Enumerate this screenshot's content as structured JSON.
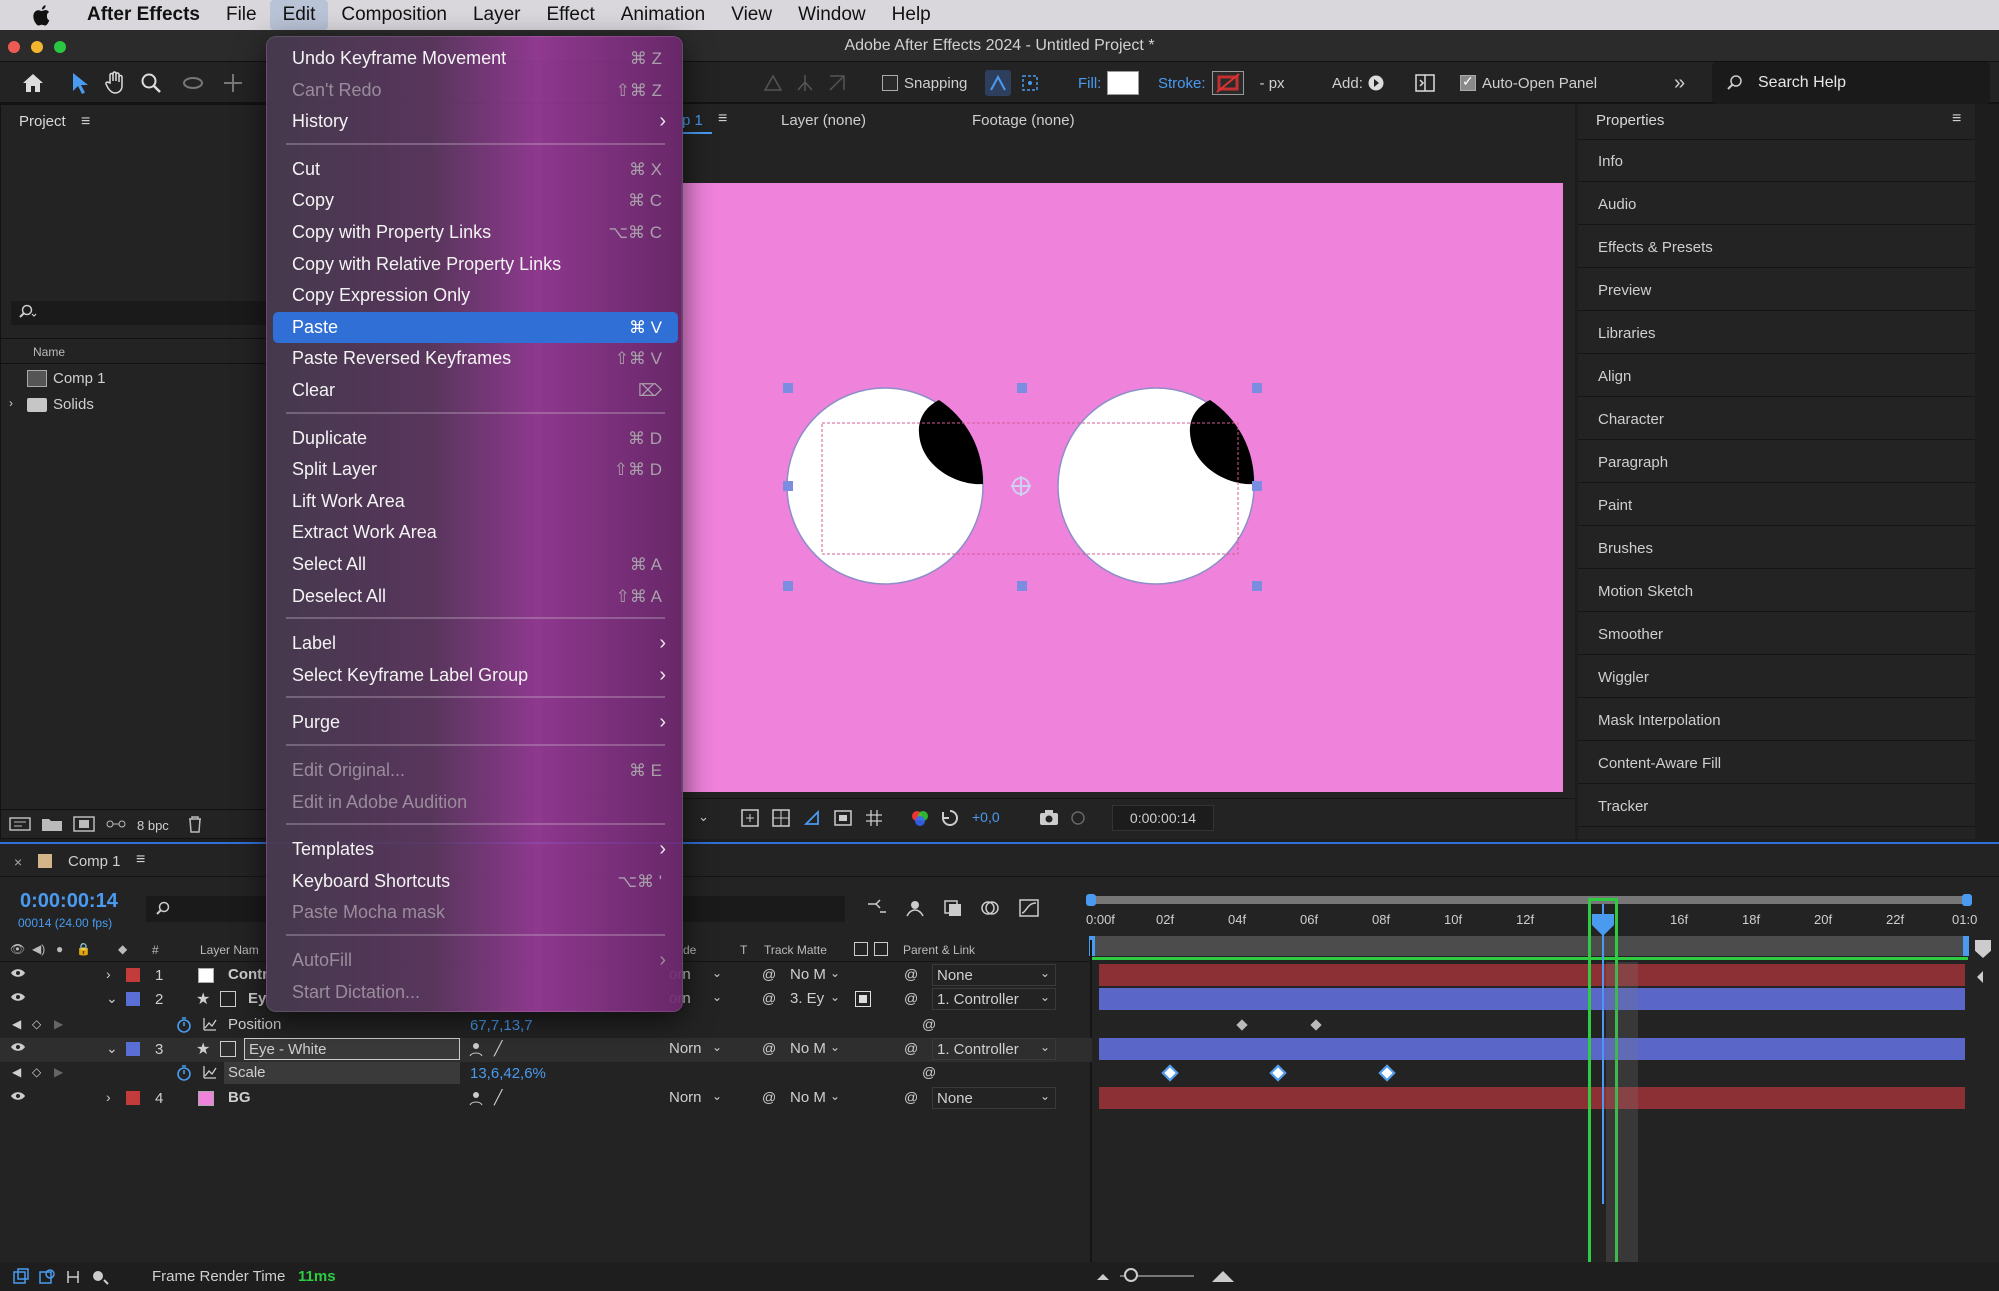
{
  "menubar": {
    "app": "After Effects",
    "items": [
      "File",
      "Edit",
      "Composition",
      "Layer",
      "Effect",
      "Animation",
      "View",
      "Window",
      "Help"
    ],
    "active": "Edit"
  },
  "window": {
    "title": "Adobe After Effects 2024 - Untitled Project *"
  },
  "toolbar": {
    "snapping": "Snapping",
    "fill": "Fill:",
    "stroke": "Stroke:",
    "stroke_unit": "- px",
    "add": "Add:",
    "auto_open": "Auto-Open Panel",
    "search_help": "Search Help",
    "colors": {
      "fill": "#ffffff",
      "stroke": "#c43030"
    }
  },
  "project": {
    "title": "Project",
    "name_col": "Name",
    "items": [
      {
        "label": "Comp 1",
        "icon": "comp-icon"
      },
      {
        "label": "Solids",
        "icon": "folder-icon"
      }
    ],
    "bpc": "8 bpc"
  },
  "viewer": {
    "tab_comp": "p 1",
    "tab_layer": "Layer (none)",
    "tab_footage": "Footage (none)",
    "exposure": "+0,0",
    "timecode": "0:00:00:14",
    "bg_color": "#ef82db"
  },
  "properties": {
    "title": "Properties",
    "items": [
      "Info",
      "Audio",
      "Effects & Presets",
      "Preview",
      "Libraries",
      "Align",
      "Character",
      "Paragraph",
      "Paint",
      "Brushes",
      "Motion Sketch",
      "Smoother",
      "Wiggler",
      "Mask Interpolation",
      "Content-Aware Fill",
      "Tracker"
    ]
  },
  "edit_menu": {
    "items": [
      {
        "label": "Undo Keyframe Movement",
        "shortcut": "⌘ Z"
      },
      {
        "label": "Can't Redo",
        "shortcut": "⇧⌘ Z",
        "disabled": true
      },
      {
        "label": "History",
        "submenu": true
      },
      {
        "sep": true
      },
      {
        "label": "Cut",
        "shortcut": "⌘ X"
      },
      {
        "label": "Copy",
        "shortcut": "⌘ C"
      },
      {
        "label": "Copy with Property Links",
        "shortcut": "⌥⌘ C"
      },
      {
        "label": "Copy with Relative Property Links"
      },
      {
        "label": "Copy Expression Only"
      },
      {
        "label": "Paste",
        "shortcut": "⌘ V",
        "selected": true
      },
      {
        "label": "Paste Reversed Keyframes",
        "shortcut": "⇧⌘ V"
      },
      {
        "label": "Clear",
        "shortcut": "⌦"
      },
      {
        "sep": true
      },
      {
        "label": "Duplicate",
        "shortcut": "⌘ D"
      },
      {
        "label": "Split Layer",
        "shortcut": "⇧⌘ D"
      },
      {
        "label": "Lift Work Area"
      },
      {
        "label": "Extract Work Area"
      },
      {
        "label": "Select All",
        "shortcut": "⌘ A"
      },
      {
        "label": "Deselect All",
        "shortcut": "⇧⌘ A"
      },
      {
        "sep": true
      },
      {
        "label": "Label",
        "submenu": true
      },
      {
        "label": "Select Keyframe Label Group",
        "submenu": true
      },
      {
        "sep": true
      },
      {
        "label": "Purge",
        "submenu": true
      },
      {
        "sep": true
      },
      {
        "label": "Edit Original...",
        "shortcut": "⌘ E",
        "disabled": true
      },
      {
        "label": "Edit in Adobe Audition",
        "disabled": true
      },
      {
        "sep": true
      },
      {
        "label": "Templates",
        "submenu": true
      },
      {
        "label": "Keyboard Shortcuts",
        "shortcut": "⌥⌘ '"
      },
      {
        "label": "Paste Mocha mask",
        "disabled": true
      },
      {
        "sep": true
      },
      {
        "label": "AutoFill",
        "submenu": true,
        "disabled": true
      },
      {
        "label": "Start Dictation...",
        "disabled": true
      }
    ]
  },
  "timeline": {
    "comp_tab": "Comp 1",
    "timecode": "0:00:00:14",
    "frame_info": "00014 (24.00 fps)",
    "headers": {
      "num": "#",
      "layer_name": "Layer Nam",
      "mode": "de",
      "t": "T",
      "track_matte": "Track Matte",
      "parent": "Parent & Link"
    },
    "ruler": [
      "0:00f",
      "02f",
      "04f",
      "06f",
      "08f",
      "10f",
      "12f",
      "16f",
      "18f",
      "20f",
      "22f",
      "01:0"
    ],
    "layers": [
      {
        "num": "1",
        "name": "Contr",
        "mode": "orn",
        "matte": "No M",
        "parent": "None",
        "color": "#c43b3b",
        "swatch": "#ffffff"
      },
      {
        "num": "2",
        "name": "Ey",
        "mode": "orn",
        "matte": "3. Ey",
        "parent": "1. Controller",
        "color": "#5a6fd6"
      },
      {
        "prop": "Position",
        "value": "67,7,13,7"
      },
      {
        "num": "3",
        "name": "Eye - White",
        "mode": "Norn",
        "matte": "No M",
        "parent": "1. Controller",
        "color": "#5a6fd6"
      },
      {
        "prop": "Scale",
        "value": "13,6,42,6%"
      },
      {
        "num": "4",
        "name": "BG",
        "mode": "Norn",
        "matte": "No M",
        "parent": "None",
        "color": "#c43b3b",
        "swatch": "#ef82db"
      }
    ]
  },
  "status": {
    "render_label": "Frame Render Time",
    "render_value": "11ms"
  }
}
